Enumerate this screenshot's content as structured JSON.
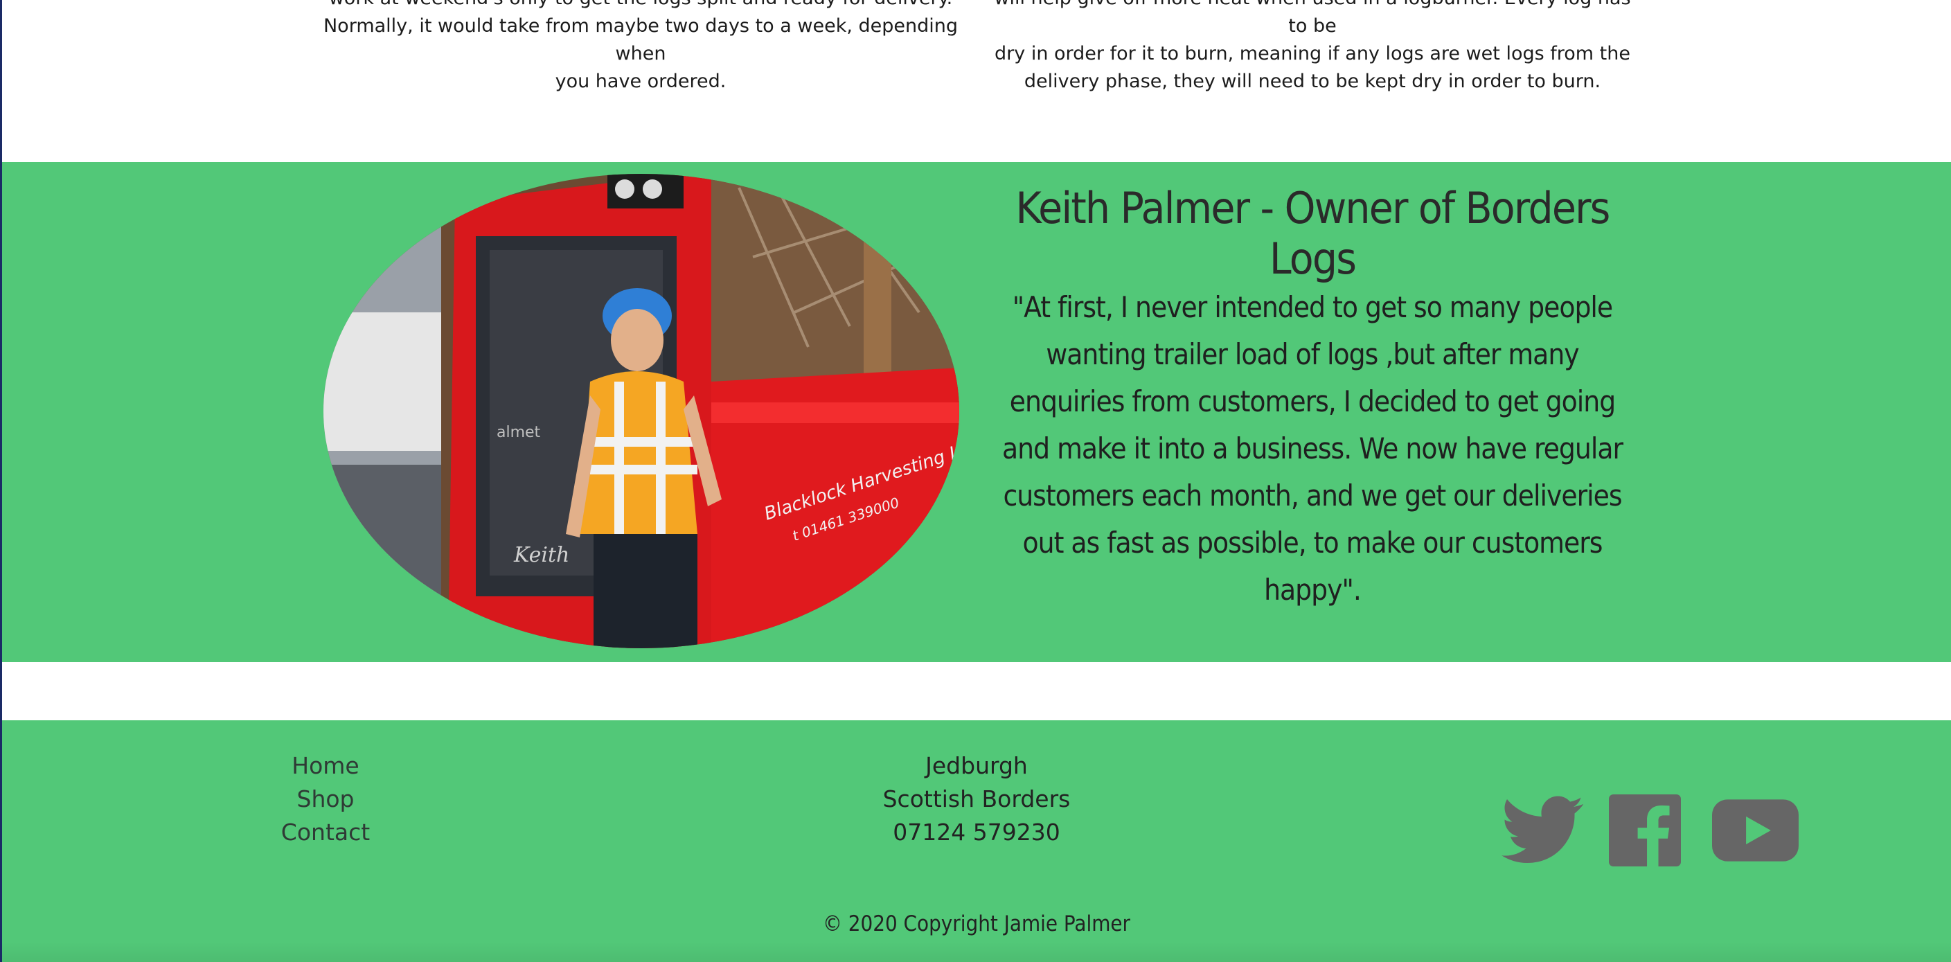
{
  "top_section": {
    "left_text_lines": [
      "work at weekend's only to get the logs split and ready for delivery.",
      "Normally, it would take from maybe two days to a week, depending when",
      "you have ordered."
    ],
    "right_text_lines": [
      "will help give off more heat when used in a logburner. Every log has to be",
      "dry in order for it to burn, meaning if any logs are wet logs from the",
      "delivery phase, they will need to be kept dry in order to burn."
    ]
  },
  "testimonial": {
    "title": "Keith Palmer - Owner of Borders Logs",
    "quote": "\"At first, I never intended to get so many people wanting trailer load of logs ,but after many enquiries from customers, I decided to get going and make it into a business. We now have regular customers each month, and we get our deliveries out as fast as possible, to make our customers happy\".",
    "photo_text": {
      "cab_brand": "almet",
      "door_script": "Keith",
      "vehicle_line1": "Blacklock Harvesting Ltd",
      "vehicle_line2": "t 01461 339000"
    }
  },
  "footer": {
    "nav": [
      {
        "label": "Home"
      },
      {
        "label": "Shop"
      },
      {
        "label": "Contact"
      }
    ],
    "contact": {
      "town": "Jedburgh",
      "region": "Scottish Borders",
      "phone": "07124 579230"
    },
    "social": [
      {
        "icon": "twitter-icon"
      },
      {
        "icon": "facebook-icon"
      },
      {
        "icon": "youtube-icon"
      }
    ],
    "copyright": "© 2020 Copyright Jamie Palmer"
  },
  "colors": {
    "band_green": "#52c878",
    "icon_grey": "#666666",
    "text_dark": "#222222"
  }
}
